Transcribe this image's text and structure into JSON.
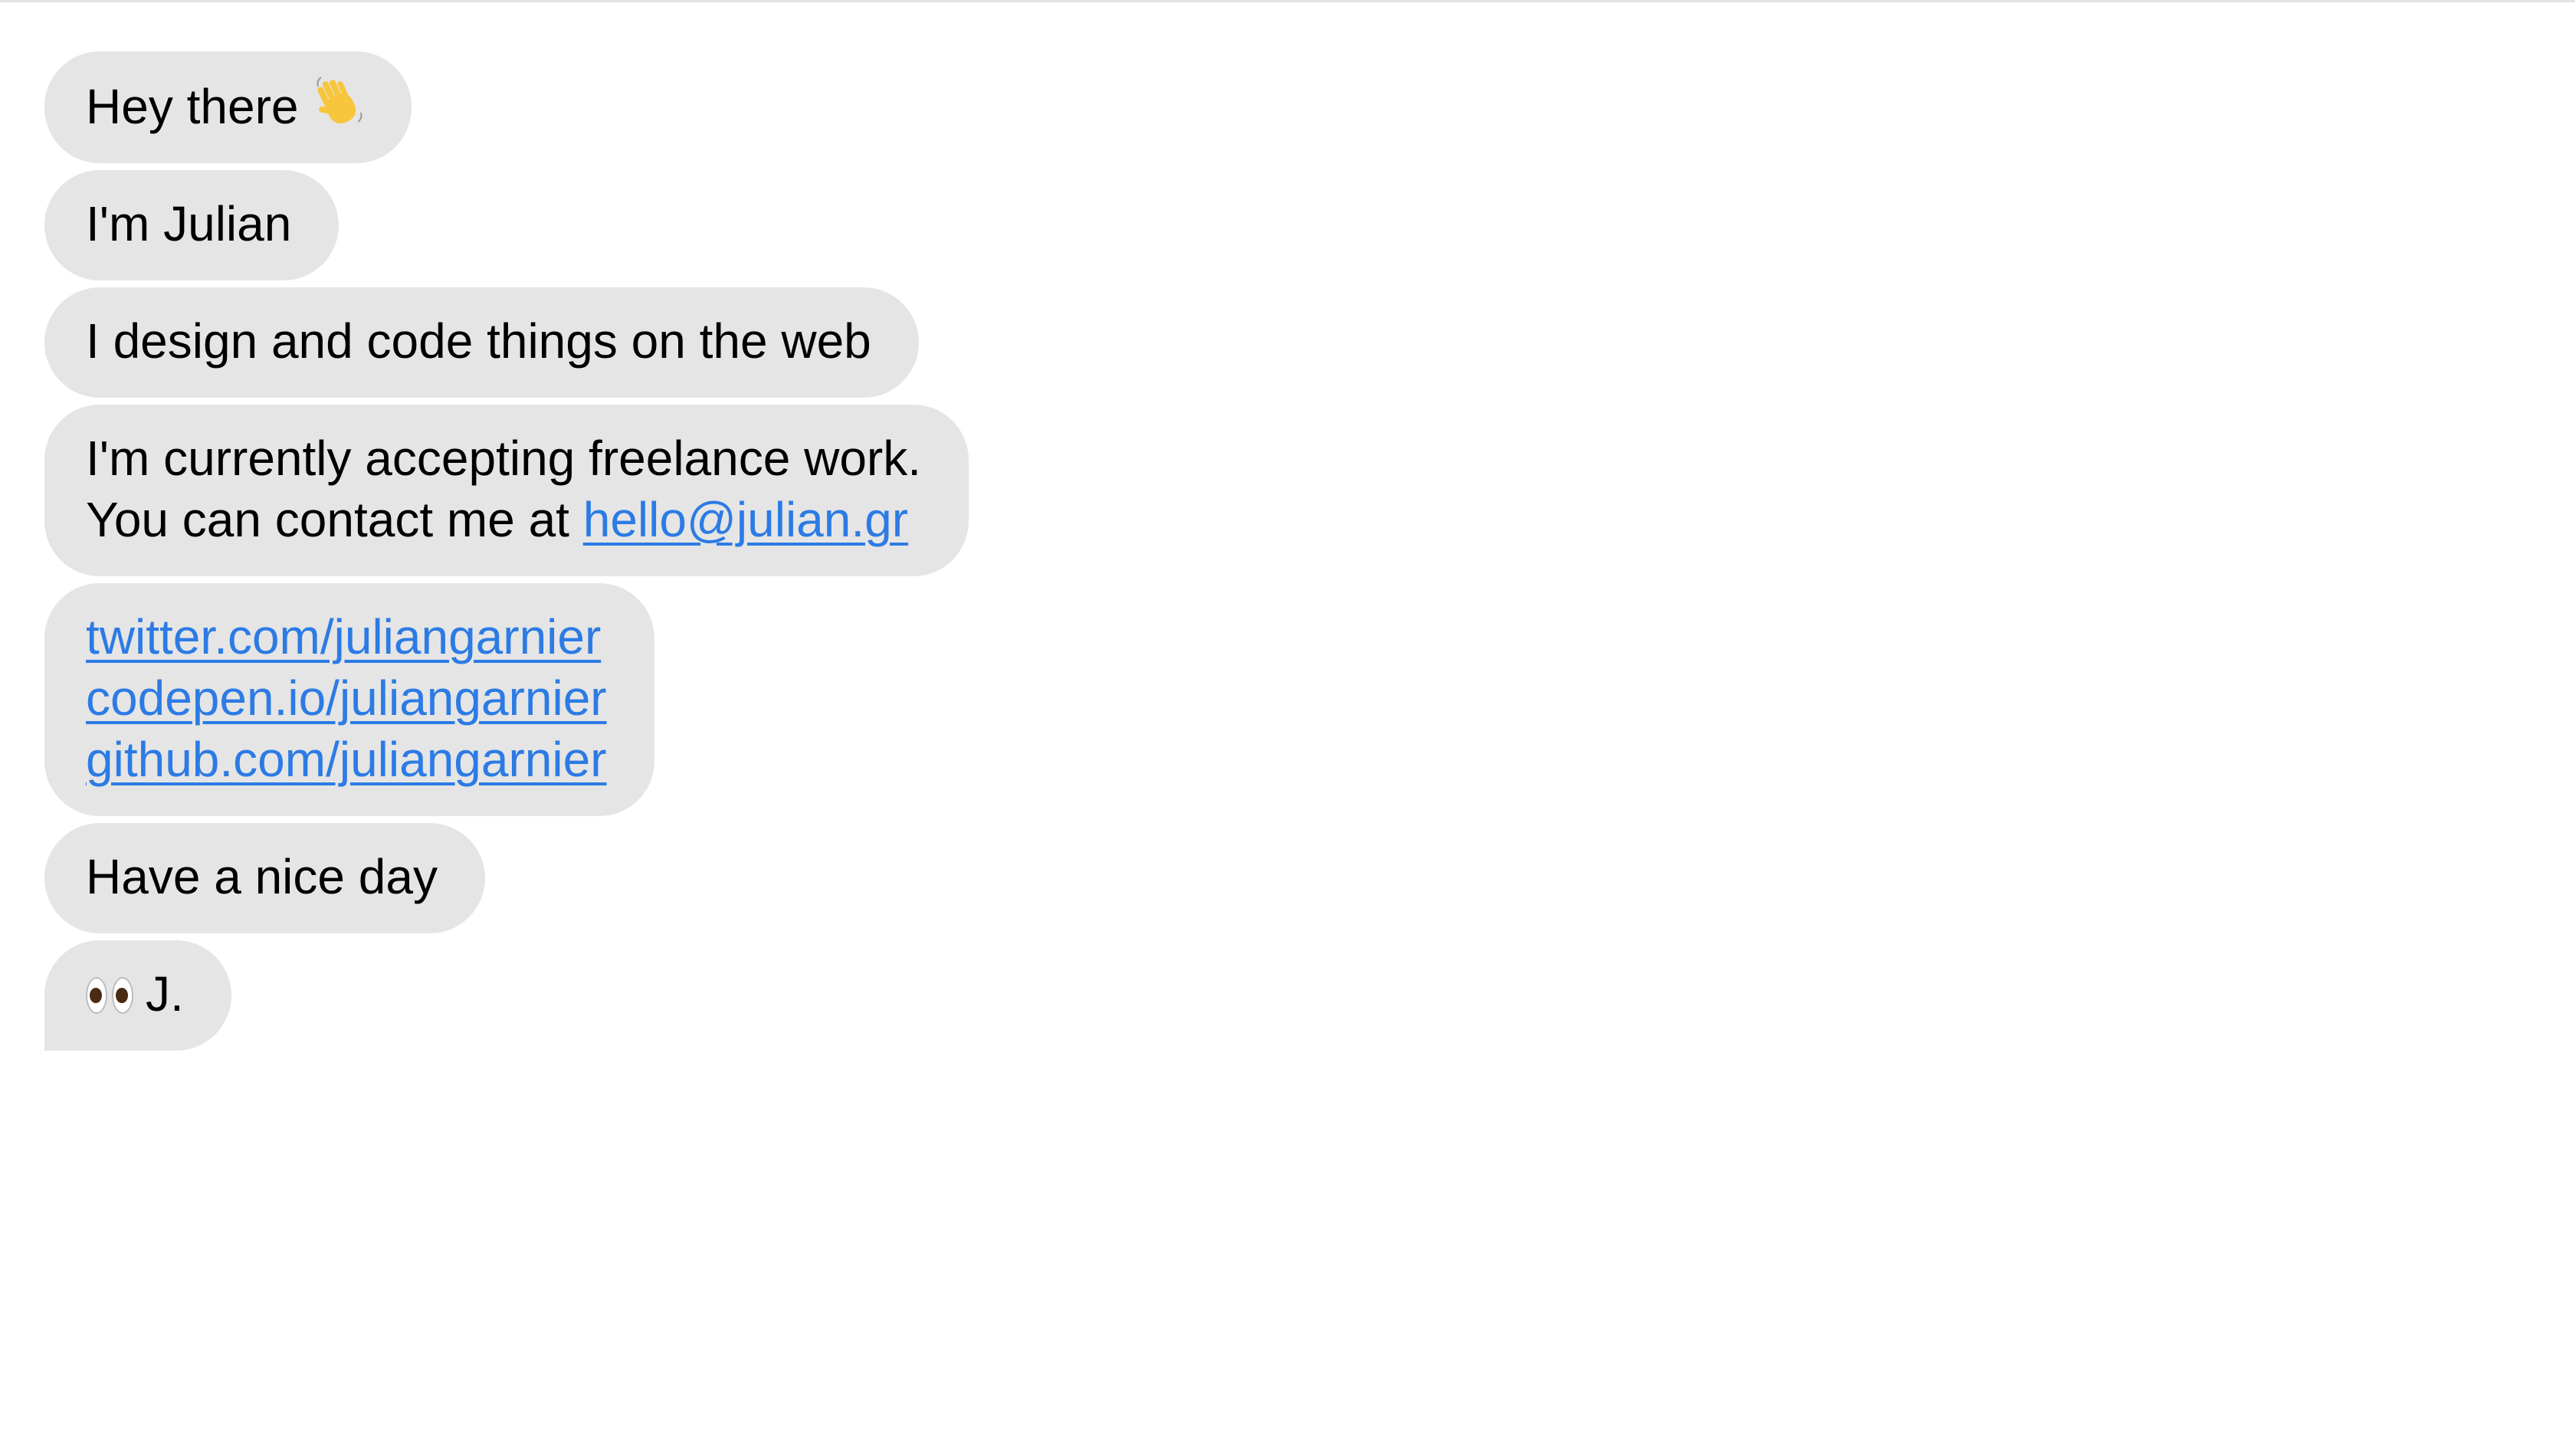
{
  "messages": [
    {
      "text": "Hey there",
      "icon": "waving-hand-icon"
    },
    {
      "text": "I'm Julian"
    },
    {
      "text": "I design and code things on the web"
    },
    {
      "line1": "I'm currently accepting freelance work.",
      "line2_prefix": "You can contact me at ",
      "email": "hello@julian.gr"
    },
    {
      "links": [
        "twitter.com/juliangarnier",
        "codepen.io/juliangarnier",
        "github.com/juliangarnier"
      ]
    },
    {
      "text": "Have a nice day"
    },
    {
      "text": "J.",
      "icon": "eyes-icon"
    }
  ],
  "colors": {
    "bubble": "#e5e5e5",
    "link": "#2c7be5",
    "text": "#000000",
    "background": "#ffffff"
  }
}
